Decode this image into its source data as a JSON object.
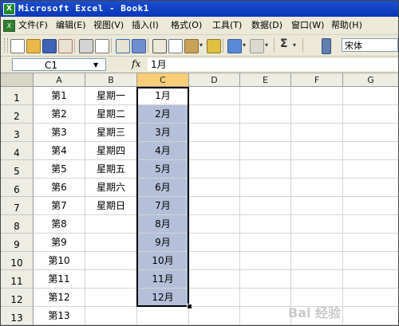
{
  "window": {
    "title": "Microsoft Excel - Book1"
  },
  "menu": {
    "items": [
      "文件(F)",
      "编辑(E)",
      "视图(V)",
      "插入(I)",
      "格式(O)",
      "工具(T)",
      "数据(D)",
      "窗口(W)",
      "帮助(H)"
    ]
  },
  "toolbar": {
    "icons": [
      "new-icon",
      "open-icon",
      "save-icon",
      "permission-icon",
      "print-icon",
      "print-preview-icon",
      "spelling-icon",
      "research-icon",
      "cut-icon",
      "copy-icon",
      "paste-icon",
      "format-painter-icon",
      "undo-icon",
      "redo-icon",
      "autosum-icon",
      "options-icon"
    ],
    "font_name": "宋体",
    "autosum_label": "Σ"
  },
  "formula_bar": {
    "name_box": "C1",
    "fx_label": "fx",
    "value": "1月"
  },
  "sheet": {
    "columns": [
      "A",
      "B",
      "C",
      "D",
      "E",
      "F",
      "G"
    ],
    "selected_column": "C",
    "active_cell": "C1",
    "rows": [
      {
        "num": "1",
        "A": "第1",
        "B": "星期一",
        "C": "1月"
      },
      {
        "num": "2",
        "A": "第2",
        "B": "星期二",
        "C": "2月"
      },
      {
        "num": "3",
        "A": "第3",
        "B": "星期三",
        "C": "3月"
      },
      {
        "num": "4",
        "A": "第4",
        "B": "星期四",
        "C": "4月"
      },
      {
        "num": "5",
        "A": "第5",
        "B": "星期五",
        "C": "5月"
      },
      {
        "num": "6",
        "A": "第6",
        "B": "星期六",
        "C": "6月"
      },
      {
        "num": "7",
        "A": "第7",
        "B": "星期日",
        "C": "7月"
      },
      {
        "num": "8",
        "A": "第8",
        "B": "",
        "C": "8月"
      },
      {
        "num": "9",
        "A": "第9",
        "B": "",
        "C": "9月"
      },
      {
        "num": "10",
        "A": "第10",
        "B": "",
        "C": "10月"
      },
      {
        "num": "11",
        "A": "第11",
        "B": "",
        "C": "11月"
      },
      {
        "num": "12",
        "A": "第12",
        "B": "",
        "C": "12月"
      },
      {
        "num": "13",
        "A": "第13",
        "B": "",
        "C": ""
      }
    ]
  },
  "watermark": "Bai 经验"
}
